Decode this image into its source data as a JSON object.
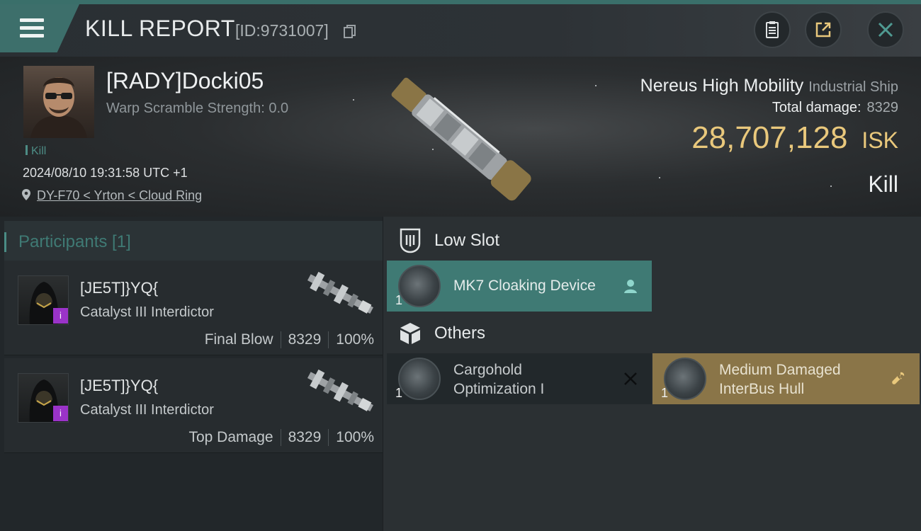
{
  "header": {
    "title": "KILL REPORT",
    "id_text": "[ID:9731007]"
  },
  "victim": {
    "name": "[RADY]Docki05",
    "warp_scramble": "Warp Scramble Strength: 0.0",
    "tag": "Kill",
    "datetime": "2024/08/10 19:31:58 UTC +1",
    "location": "DY-F70 < Yrton < Cloud Ring"
  },
  "ship": {
    "name": "Nereus High Mobility",
    "class": "Industrial Ship",
    "total_damage_label": "Total damage:",
    "total_damage_value": "8329",
    "isk_value": "28,707,128",
    "isk_unit": "ISK",
    "result": "Kill"
  },
  "participants": {
    "heading": "Participants [1]",
    "rows": [
      {
        "name": "[JE5T]}YQ{",
        "ship": "Catalyst III Interdictor",
        "role": "Final Blow",
        "damage": "8329",
        "percent": "100%"
      },
      {
        "name": "[JE5T]}YQ{",
        "ship": "Catalyst III Interdictor",
        "role": "Top Damage",
        "damage": "8329",
        "percent": "100%"
      }
    ]
  },
  "fitting": {
    "low_slot_label": "Low Slot",
    "low_slot_items": [
      {
        "name": "MK7 Cloaking Device",
        "qty": "1",
        "status": "dropped",
        "color": "#3f7a74"
      }
    ],
    "others_label": "Others",
    "others_items": [
      {
        "name_line1": "Cargohold",
        "name_line2": "Optimization I",
        "qty": "1",
        "status": "destroyed",
        "color": "#22282b"
      },
      {
        "name_line1": "Medium Damaged",
        "name_line2": "InterBus Hull",
        "qty": "1",
        "status": "salvage",
        "color": "#8a7548"
      }
    ]
  },
  "icons": [
    "menu-icon",
    "copy-icon",
    "clipboard-icon",
    "share-icon",
    "close-icon",
    "location-pin-icon",
    "low-slot-icon",
    "cube-icon",
    "person-icon",
    "cross-icon",
    "wrench-icon"
  ]
}
